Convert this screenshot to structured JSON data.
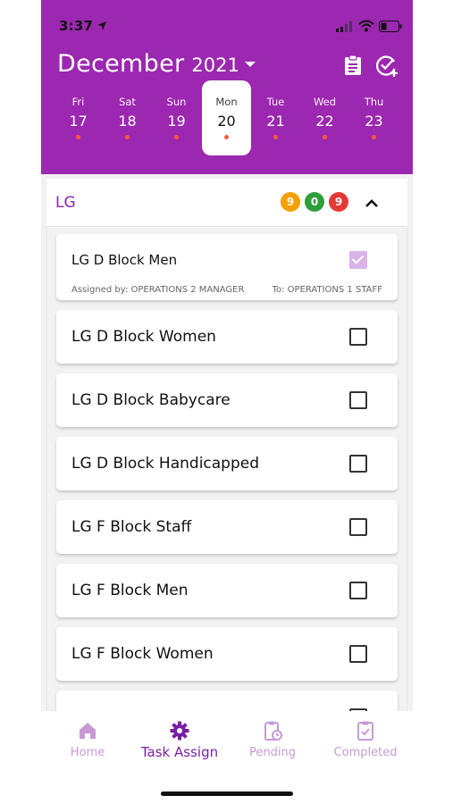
{
  "status_bar": {
    "time": "3:37"
  },
  "header": {
    "month": "December",
    "year": "2021",
    "days": [
      {
        "name": "Fri",
        "date": "17",
        "selected": false
      },
      {
        "name": "Sat",
        "date": "18",
        "selected": false
      },
      {
        "name": "Sun",
        "date": "19",
        "selected": false
      },
      {
        "name": "Mon",
        "date": "20",
        "selected": true
      },
      {
        "name": "Tue",
        "date": "21",
        "selected": false
      },
      {
        "name": "Wed",
        "date": "22",
        "selected": false
      },
      {
        "name": "Thu",
        "date": "23",
        "selected": false
      }
    ]
  },
  "group": {
    "title": "LG",
    "badges": [
      {
        "value": "9",
        "color": "#f5a000"
      },
      {
        "value": "0",
        "color": "#2e9e3a"
      },
      {
        "value": "9",
        "color": "#e53935"
      }
    ]
  },
  "tasks": [
    {
      "title": "LG D Block Men",
      "checked": true,
      "assigned_by": "Assigned by: OPERATIONS 2 MANAGER",
      "assigned_to": "To: OPERATIONS 1 STAFF"
    },
    {
      "title": "LG D Block Women",
      "checked": false
    },
    {
      "title": "LG D Block Babycare",
      "checked": false
    },
    {
      "title": "LG D Block Handicapped",
      "checked": false
    },
    {
      "title": "LG F Block Staff",
      "checked": false
    },
    {
      "title": "LG F Block Men",
      "checked": false
    },
    {
      "title": "LG F Block Women",
      "checked": false
    }
  ],
  "nav": {
    "items": [
      {
        "label": "Home",
        "icon": "home-icon"
      },
      {
        "label": "Task Assign",
        "icon": "gear-icon",
        "active": true
      },
      {
        "label": "Pending",
        "icon": "clipboard-clock-icon"
      },
      {
        "label": "Completed",
        "icon": "clipboard-check-icon"
      }
    ]
  },
  "colors": {
    "brand": "#9c27b0",
    "accent_dot": "#ff5a36",
    "nav_inactive": "#c79ad6",
    "nav_active": "#7b1fa2"
  }
}
